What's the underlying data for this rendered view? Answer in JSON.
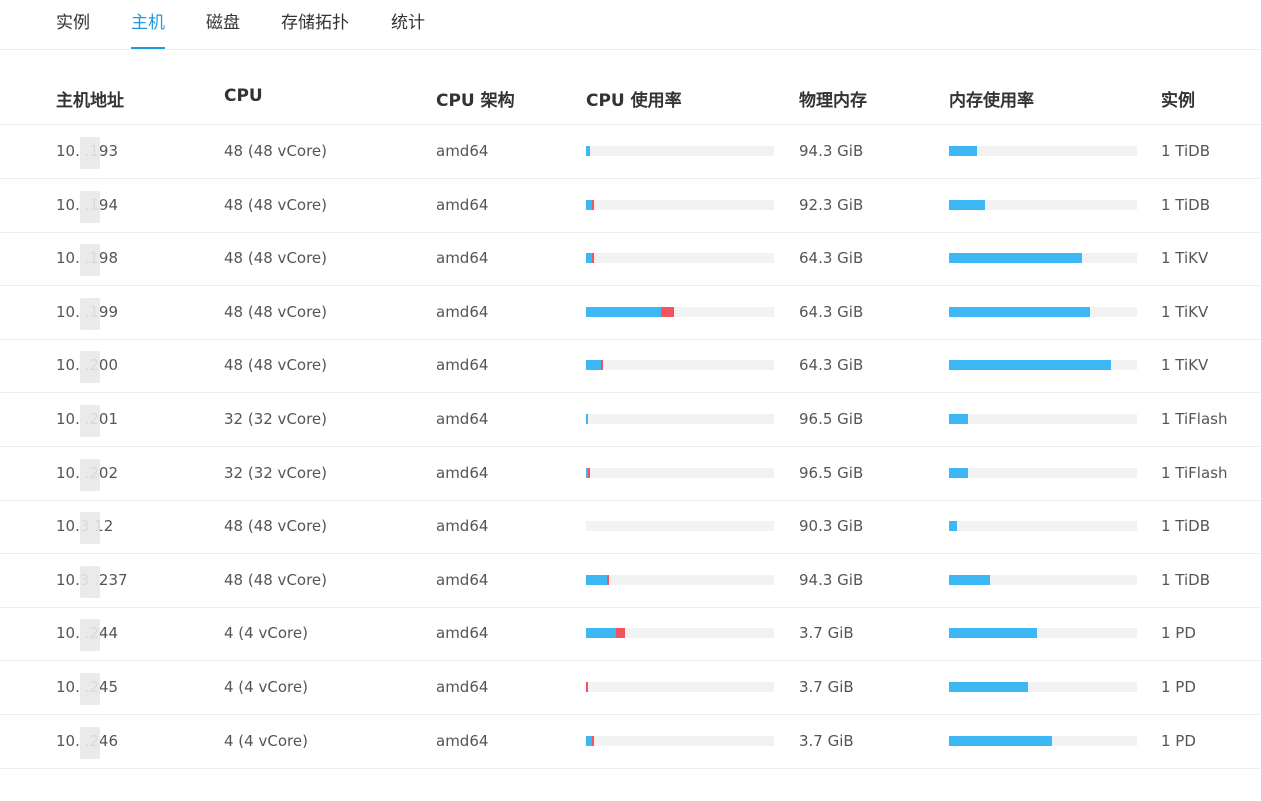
{
  "tabs": [
    {
      "label": "实例"
    },
    {
      "label": "主机",
      "active": true
    },
    {
      "label": "磁盘"
    },
    {
      "label": "存储拓扑"
    },
    {
      "label": "统计"
    }
  ],
  "table": {
    "headers": [
      "主机地址",
      "CPU",
      "CPU 架构",
      "CPU 使用率",
      "物理内存",
      "内存使用率",
      "实例"
    ],
    "rows": [
      {
        "host": "10.  .193",
        "cpu": "48 (48 vCore)",
        "arch": "amd64",
        "cpu_user": 0.02,
        "cpu_sys": 0.0,
        "memory": "94.3 GiB",
        "mem_usage": 0.15,
        "instances": "1 TiDB"
      },
      {
        "host": "10.  .194",
        "cpu": "48 (48 vCore)",
        "arch": "amd64",
        "cpu_user": 0.03,
        "cpu_sys": 0.01,
        "memory": "92.3 GiB",
        "mem_usage": 0.19,
        "instances": "1 TiDB"
      },
      {
        "host": "10.  .198",
        "cpu": "48 (48 vCore)",
        "arch": "amd64",
        "cpu_user": 0.03,
        "cpu_sys": 0.01,
        "memory": "64.3 GiB",
        "mem_usage": 0.71,
        "instances": "1 TiKV"
      },
      {
        "host": "10.  .199",
        "cpu": "48 (48 vCore)",
        "arch": "amd64",
        "cpu_user": 0.4,
        "cpu_sys": 0.07,
        "memory": "64.3 GiB",
        "mem_usage": 0.75,
        "instances": "1 TiKV"
      },
      {
        "host": "10.  .200",
        "cpu": "48 (48 vCore)",
        "arch": "amd64",
        "cpu_user": 0.08,
        "cpu_sys": 0.01,
        "memory": "64.3 GiB",
        "mem_usage": 0.86,
        "instances": "1 TiKV"
      },
      {
        "host": "10.  .201",
        "cpu": "32 (32 vCore)",
        "arch": "amd64",
        "cpu_user": 0.01,
        "cpu_sys": 0.0,
        "memory": "96.5 GiB",
        "mem_usage": 0.1,
        "instances": "1 TiFlash"
      },
      {
        "host": "10.  .202",
        "cpu": "32 (32 vCore)",
        "arch": "amd64",
        "cpu_user": 0.01,
        "cpu_sys": 0.01,
        "memory": "96.5 GiB",
        "mem_usage": 0.1,
        "instances": "1 TiFlash"
      },
      {
        "host": "10.3   12",
        "cpu": "48 (48 vCore)",
        "arch": "amd64",
        "cpu_user": 0.0,
        "cpu_sys": 0.0,
        "memory": "90.3 GiB",
        "mem_usage": 0.04,
        "instances": "1 TiDB"
      },
      {
        "host": "10.3  .237",
        "cpu": "48 (48 vCore)",
        "arch": "amd64",
        "cpu_user": 0.11,
        "cpu_sys": 0.01,
        "memory": "94.3 GiB",
        "mem_usage": 0.22,
        "instances": "1 TiDB"
      },
      {
        "host": "10.  .244",
        "cpu": "4 (4 vCore)",
        "arch": "amd64",
        "cpu_user": 0.16,
        "cpu_sys": 0.05,
        "memory": "3.7 GiB",
        "mem_usage": 0.47,
        "instances": "1 PD"
      },
      {
        "host": "10.  .245",
        "cpu": "4 (4 vCore)",
        "arch": "amd64",
        "cpu_user": 0.0,
        "cpu_sys": 0.01,
        "memory": "3.7 GiB",
        "mem_usage": 0.42,
        "instances": "1 PD"
      },
      {
        "host": "10.  .246",
        "cpu": "4 (4 vCore)",
        "arch": "amd64",
        "cpu_user": 0.03,
        "cpu_sys": 0.01,
        "memory": "3.7 GiB",
        "mem_usage": 0.55,
        "instances": "1 PD"
      }
    ]
  },
  "colors": {
    "accent": "#1e9bdc",
    "bar_user": "#3db8f5",
    "bar_sys": "#f2545b",
    "bar_track": "#f2f2f2"
  }
}
